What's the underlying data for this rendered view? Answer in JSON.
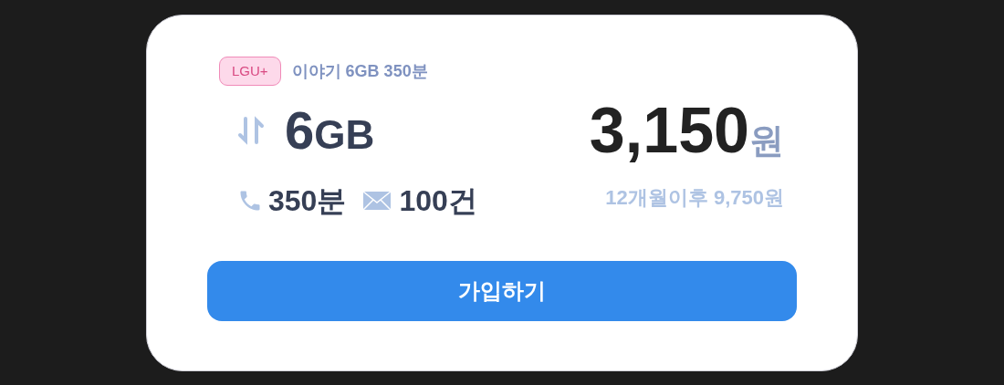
{
  "carrier": "LGU+",
  "plan_name": "이야기 6GB 350분",
  "data_amount": "6",
  "data_unit": "GB",
  "price": "3,150",
  "price_unit": "원",
  "voice": "350분",
  "sms": "100건",
  "price_after": "12개월이후 9,750원",
  "button": "가입하기"
}
